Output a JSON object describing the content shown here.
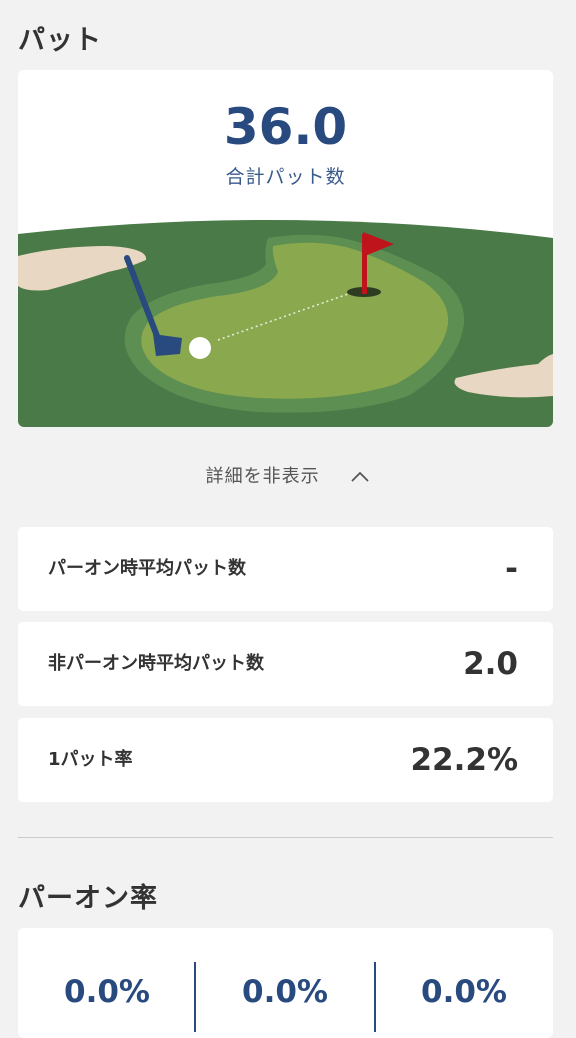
{
  "putt_section": {
    "title": "パット",
    "total_value": "36.0",
    "total_label": "合計パット数"
  },
  "toggle": {
    "label": "詳細を非表示"
  },
  "stats": [
    {
      "label": "パーオン時平均パット数",
      "value": "-"
    },
    {
      "label": "非パーオン時平均パット数",
      "value": "2.0"
    },
    {
      "label": "1パット率",
      "value": "22.2%"
    }
  ],
  "paron_section": {
    "title": "パーオン率",
    "values": [
      "0.0%",
      "0.0%",
      "0.0%"
    ]
  },
  "colors": {
    "accent_navy": "#284a7e",
    "fairway": "#4a7a48",
    "green": "#8aa84e",
    "sand": "#e9d8c4",
    "flag": "#c0141c"
  },
  "icons": {
    "toggle": "chevron-up-icon"
  }
}
